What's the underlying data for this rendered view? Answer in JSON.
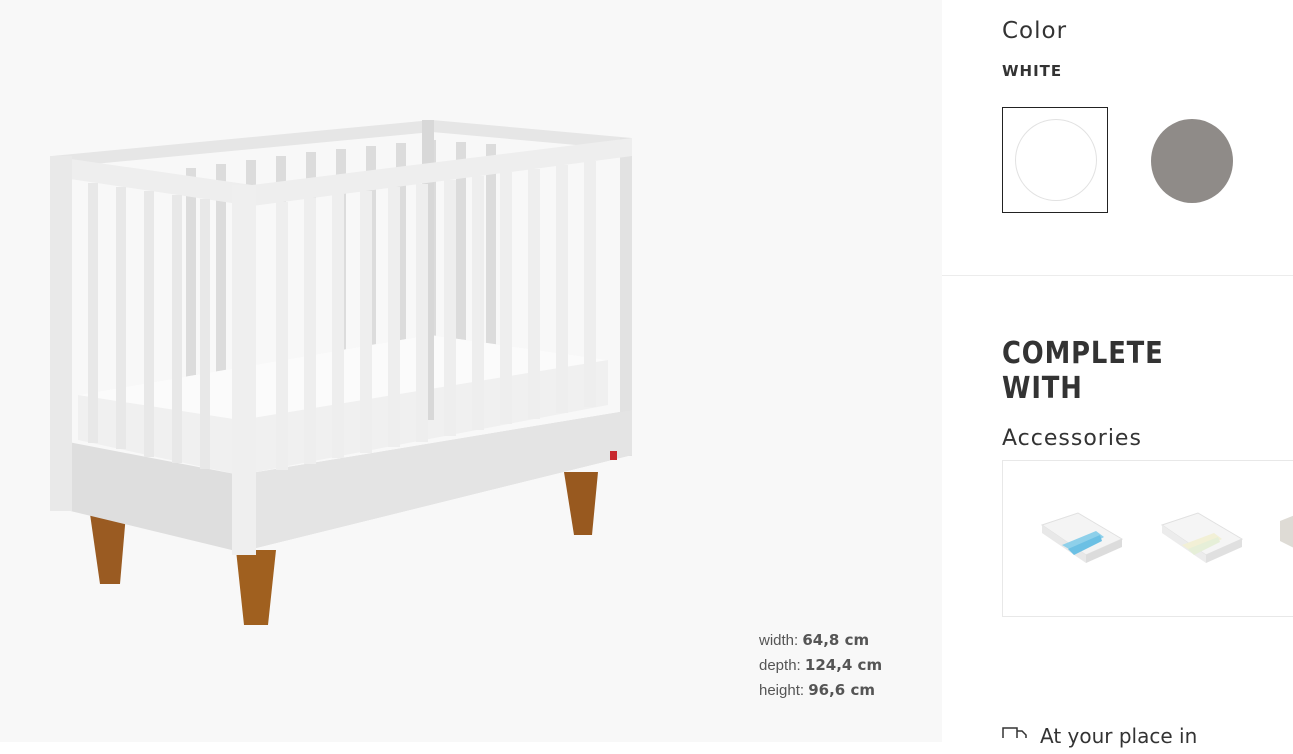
{
  "product": {
    "dimensions": [
      {
        "label": "width:",
        "value": "64,8 cm"
      },
      {
        "label": "depth:",
        "value": "124,4 cm"
      },
      {
        "label": "height:",
        "value": "96,6 cm"
      }
    ]
  },
  "color": {
    "label": "Color",
    "selected_value": "WHITE",
    "swatches": [
      {
        "name": "white",
        "hex": "#ffffff",
        "selected": true
      },
      {
        "name": "grey",
        "hex": "#8f8b88",
        "selected": false
      }
    ]
  },
  "complete_with": {
    "heading": "COMPLETE WITH",
    "accessories_label": "Accessories"
  },
  "delivery": {
    "text": "At your place in"
  }
}
